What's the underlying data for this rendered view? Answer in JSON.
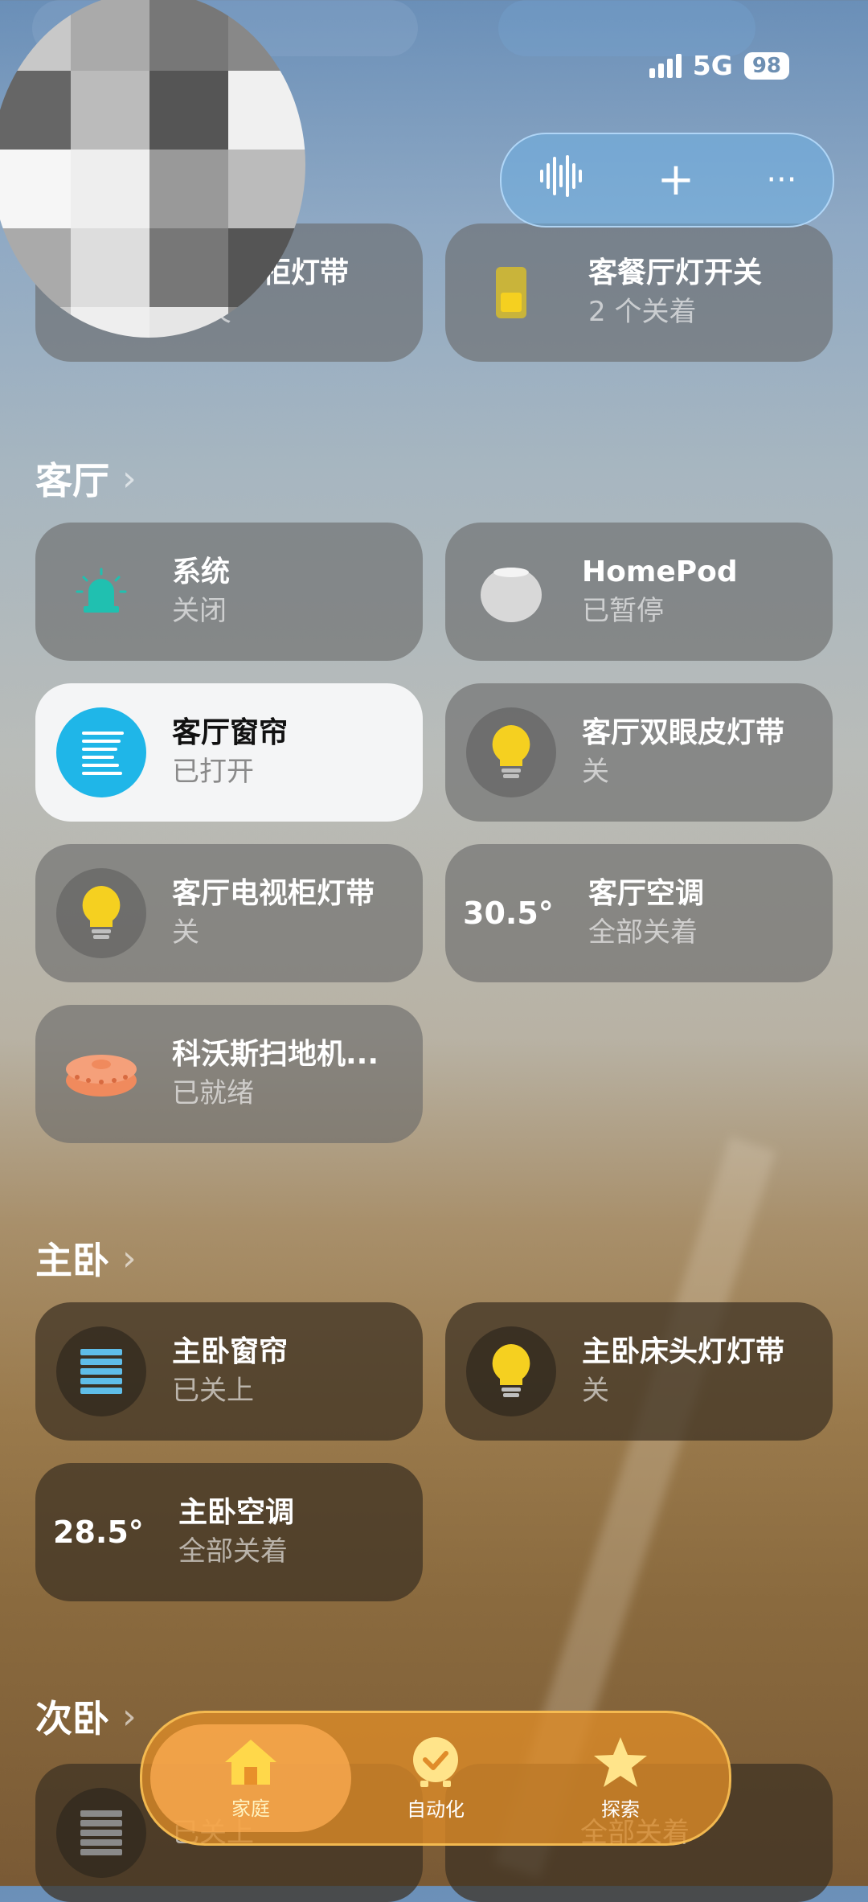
{
  "status_bar": {
    "network": "5G",
    "battery": "98"
  },
  "top_menu": {
    "voice": "voice-icon",
    "add": "+",
    "more": "···"
  },
  "prev_section": {
    "tiles": [
      {
        "name": "餐边柜灯带",
        "status": "关"
      },
      {
        "name": "客餐厅灯开关",
        "status": "2 个关着"
      }
    ]
  },
  "living_room": {
    "title": "客厅",
    "tiles": [
      {
        "name": "系统",
        "status": "关闭"
      },
      {
        "name": "HomePod",
        "status": "已暂停"
      },
      {
        "name": "客厅窗帘",
        "status": "已打开"
      },
      {
        "name": "客厅双眼皮灯带",
        "status": "关"
      },
      {
        "name": "客厅电视柜灯带",
        "status": "关"
      },
      {
        "name": "客厅空调",
        "status": "全部关着",
        "temp": "30.5°"
      },
      {
        "name": "科沃斯扫地机...",
        "status": "已就绪"
      }
    ]
  },
  "master_bedroom": {
    "title": "主卧",
    "tiles": [
      {
        "name": "主卧窗帘",
        "status": "已关上"
      },
      {
        "name": "主卧床头灯灯带",
        "status": "关"
      },
      {
        "name": "主卧空调",
        "status": "全部关着",
        "temp": "28.5°"
      }
    ]
  },
  "second_bedroom": {
    "title": "次卧",
    "tiles": [
      {
        "name": "",
        "status": "已关上"
      },
      {
        "name": "",
        "status": "全部关着"
      }
    ]
  },
  "tab_bar": {
    "tabs": [
      {
        "label": "家庭",
        "icon": "house-icon",
        "active": true
      },
      {
        "label": "自动化",
        "icon": "clock-check-icon",
        "active": false
      },
      {
        "label": "探索",
        "icon": "star-icon",
        "active": false
      }
    ]
  },
  "colors": {
    "accent_blue": "#1fb6e8",
    "bulb_yellow": "#f5d020",
    "robot_orange": "#f08a5d",
    "tab_orange": "#e08c2a",
    "security_teal": "#20c0b0"
  }
}
